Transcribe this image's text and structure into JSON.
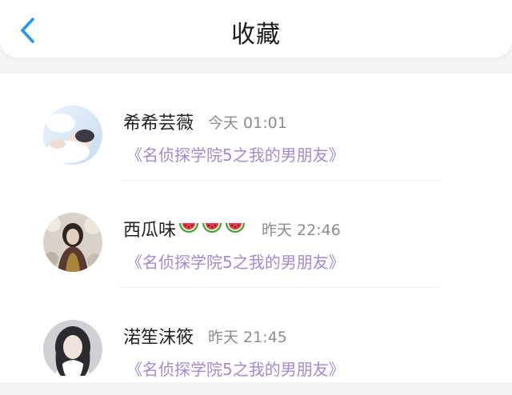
{
  "header": {
    "title": "收藏",
    "back_icon": "chevron-left-icon",
    "accent_color": "#2196f3"
  },
  "favorites": [
    {
      "name": "希希芸薇",
      "emoji_icons": [],
      "time": "今天 01:01",
      "book": "《名侦探学院5之我的男朋友》"
    },
    {
      "name": "西瓜味",
      "emoji_icons": [
        "watermelon-icon",
        "watermelon-icon",
        "watermelon-icon"
      ],
      "time": "昨天 22:46",
      "book": "《名侦探学院5之我的男朋友》"
    },
    {
      "name": "渃笙沫筱",
      "emoji_icons": [],
      "time": "昨天 21:45",
      "book": "《名侦探学院5之我的男朋友》"
    }
  ],
  "colors": {
    "book_link": "#a58ad0",
    "time_text": "#8c8c8c",
    "name_text": "#222222"
  }
}
